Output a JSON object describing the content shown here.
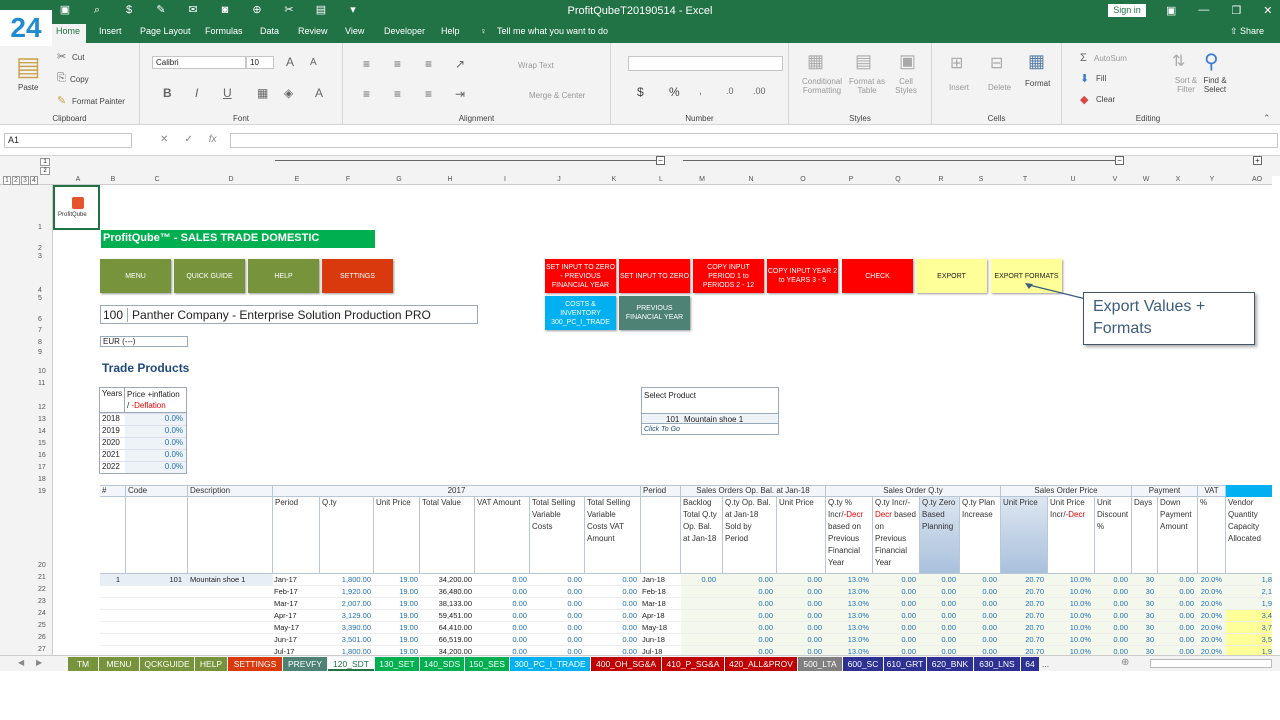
{
  "window": {
    "title": "ProfitQubeT20190514  -  Excel",
    "sign_in": "Sign in",
    "share": "Share",
    "tell_me": "Tell me what you want to do",
    "badge": "24"
  },
  "tabs": [
    "Home",
    "Insert",
    "Page Layout",
    "Formulas",
    "Data",
    "Review",
    "View",
    "Developer",
    "Help"
  ],
  "ribbon": {
    "clipboard": {
      "paste": "Paste",
      "cut": "Cut",
      "copy": "Copy",
      "format_painter": "Format Painter",
      "name": "Clipboard"
    },
    "font": {
      "family": "Calibri",
      "size": "10",
      "name": "Font"
    },
    "alignment": {
      "wrap": "Wrap Text",
      "merge": "Merge & Center",
      "name": "Alignment"
    },
    "number": {
      "name": "Number",
      "dollar": "$",
      "percent": "%"
    },
    "styles": {
      "cond": "Conditional Formatting",
      "fmt_table": "Format as Table",
      "cell_styles": "Cell Styles",
      "name": "Styles"
    },
    "cells": {
      "insert": "Insert",
      "delete": "Delete",
      "format": "Format",
      "name": "Cells"
    },
    "editing": {
      "autosum": "AutoSum",
      "fill": "Fill",
      "clear": "Clear",
      "sort": "Sort & Filter",
      "find": "Find & Select",
      "name": "Editing"
    }
  },
  "formula_bar": {
    "cell": "A1",
    "fx": "fx"
  },
  "outline_levels": [
    "1",
    "2",
    "3",
    "4"
  ],
  "columns": [
    "A",
    "B",
    "C",
    "D",
    "E",
    "F",
    "G",
    "H",
    "I",
    "J",
    "K",
    "L",
    "M",
    "N",
    "O",
    "P",
    "Q",
    "R",
    "S",
    "T",
    "U",
    "V",
    "W",
    "X",
    "Y",
    "AO"
  ],
  "rows": [
    "1",
    "2",
    "3",
    "4",
    "5",
    "6",
    "7",
    "8",
    "9",
    "10",
    "11",
    "12",
    "13",
    "14",
    "15",
    "16",
    "17",
    "18",
    "19",
    "20",
    "21",
    "22",
    "23",
    "24",
    "25",
    "26",
    "27"
  ],
  "sheet": {
    "logo_text": "ProfitQube",
    "title": "ProfitQube™ - SALES TRADE DOMESTIC",
    "nav_buttons": [
      "MENU",
      "QUICK GUIDE",
      "HELP",
      "SETTINGS"
    ],
    "action_buttons": {
      "set_zero_prev": "SET INPUT TO ZERO - PREVIOUS FINANCIAL YEAR",
      "set_zero": "SET INPUT TO ZERO",
      "copy_p1": "COPY INPUT PERIOD 1 to PERIODS  2 - 12",
      "copy_y2": "COPY INPUT YEAR 2 to YEARS  3 - 5",
      "check": "CHECK",
      "export": "EXPORT",
      "export_formats": "EXPORT FORMATS",
      "costs": "COSTS & INVENTORY 300_PC_I_TRADE",
      "prev_fy": "PREVIOUS FINANCIAL YEAR"
    },
    "callout": "Export Values  + Formats",
    "company_code": "100",
    "company_name": "Panther Company - Enterprise Solution Production PRO",
    "currency": "EUR (---)",
    "section": "Trade Products",
    "years_table": {
      "h1": "Years",
      "h2": "Price +inflation",
      "h3": "/ ",
      "h4": "-Deflation",
      "rows": [
        {
          "y": "2018",
          "v": "0.0%"
        },
        {
          "y": "2019",
          "v": "0.0%"
        },
        {
          "y": "2020",
          "v": "0.0%"
        },
        {
          "y": "2021",
          "v": "0.0%"
        },
        {
          "y": "2022",
          "v": "0.0%"
        }
      ]
    },
    "select_product": {
      "label": "Select Product",
      "code": "101",
      "name": "Mountain shoe 1",
      "link": "Click To Go"
    },
    "grid_headers": {
      "hash": "#",
      "code": "Code",
      "desc": "Description",
      "year": "2017",
      "period": "Period",
      "qty": "Q.ty",
      "unit_price": "Unit Price",
      "total_value": "Total Value",
      "vat_amount": "VAT Amount",
      "tsvc": "Total Selling Variable Costs",
      "tsvc_vat": "Total Selling Variable Costs VAT Amount",
      "period2": "Period",
      "so_group": "Sales Orders Op. Bal. at Jan-18",
      "backlog": "Backlog Total Q.ty Op. Bal. at Jan-18",
      "qty_op": "Q.ty Op. Bal. at Jan-18 Sold by Period",
      "unit_price2": "Unit Price",
      "soq_group": "Sales Order Q.ty",
      "incr": "Q.ty % Incr/",
      "decr": "-Decr",
      "incr_tail": "based on Previous Financial Year",
      "incr2": "Q.ty Incr/-",
      "decr2": "Decr",
      "incr2_tail": "based on Previous Financial Year",
      "zero": "Q.ty Zero Based Planning",
      "plan_inc": "Q.ty Plan Increase",
      "sop_group": "Sales Order Price",
      "unit_price3": "Unit Price",
      "price_incr": "Unit Price Incr/",
      "price_decr": "-Decr",
      "discount": "Unit Discount %",
      "pay_group": "Payment",
      "days": "Days",
      "down": "Down Payment Amount",
      "vat_group": "VAT",
      "vat_pct": "%",
      "vendor": "Vendor Quantity Capacity Allocated"
    },
    "data_rows": [
      {
        "n": "1",
        "code": "101",
        "desc": "Mountain shoe 1",
        "p": "Jan-17",
        "q": "1,800.00",
        "up": "19.00",
        "tv": "34,200.00",
        "va": "0.00",
        "c1": "0.00",
        "c2": "0.00",
        "p2": "Jan-18",
        "bl": "0.00",
        "s1": "0.00",
        "s2": "0.00",
        "pc": "13.0%",
        "a": "0.00",
        "b": "0.00",
        "c": "0.00",
        "u": "20.70",
        "ui": "10.0%",
        "d": "0.00",
        "days": "30",
        "dp": "0.00",
        "vp": "20.0%",
        "ao": "1,8"
      },
      {
        "n": "",
        "code": "",
        "desc": "",
        "p": "Feb-17",
        "q": "1,920.00",
        "up": "19.00",
        "tv": "36,480.00",
        "va": "0.00",
        "c1": "0.00",
        "c2": "0.00",
        "p2": "Feb-18",
        "bl": "",
        "s1": "0.00",
        "s2": "0.00",
        "pc": "13.0%",
        "a": "0.00",
        "b": "0.00",
        "c": "0.00",
        "u": "20.70",
        "ui": "10.0%",
        "d": "0.00",
        "days": "30",
        "dp": "0.00",
        "vp": "20.0%",
        "ao": "2,1"
      },
      {
        "n": "",
        "code": "",
        "desc": "",
        "p": "Mar-17",
        "q": "2,007.00",
        "up": "19.00",
        "tv": "38,133.00",
        "va": "0.00",
        "c1": "0.00",
        "c2": "0.00",
        "p2": "Mar-18",
        "bl": "",
        "s1": "0.00",
        "s2": "0.00",
        "pc": "13.0%",
        "a": "0.00",
        "b": "0.00",
        "c": "0.00",
        "u": "20.70",
        "ui": "10.0%",
        "d": "0.00",
        "days": "30",
        "dp": "0.00",
        "vp": "20.0%",
        "ao": "1,9"
      },
      {
        "n": "",
        "code": "",
        "desc": "",
        "p": "Apr-17",
        "q": "3,129.00",
        "up": "19.00",
        "tv": "59,451.00",
        "va": "0.00",
        "c1": "0.00",
        "c2": "0.00",
        "p2": "Apr-18",
        "bl": "",
        "s1": "0.00",
        "s2": "0.00",
        "pc": "13.0%",
        "a": "0.00",
        "b": "0.00",
        "c": "0.00",
        "u": "20.70",
        "ui": "10.0%",
        "d": "0.00",
        "days": "30",
        "dp": "0.00",
        "vp": "20.0%",
        "ao": "3,4"
      },
      {
        "n": "",
        "code": "",
        "desc": "",
        "p": "May-17",
        "q": "3,390.00",
        "up": "19.00",
        "tv": "64,410.00",
        "va": "0.00",
        "c1": "0.00",
        "c2": "0.00",
        "p2": "May-18",
        "bl": "",
        "s1": "0.00",
        "s2": "0.00",
        "pc": "13.0%",
        "a": "0.00",
        "b": "0.00",
        "c": "0.00",
        "u": "20.70",
        "ui": "10.0%",
        "d": "0.00",
        "days": "30",
        "dp": "0.00",
        "vp": "20.0%",
        "ao": "3,7"
      },
      {
        "n": "",
        "code": "",
        "desc": "",
        "p": "Jun-17",
        "q": "3,501.00",
        "up": "19.00",
        "tv": "66,519.00",
        "va": "0.00",
        "c1": "0.00",
        "c2": "0.00",
        "p2": "Jun-18",
        "bl": "",
        "s1": "0.00",
        "s2": "0.00",
        "pc": "13.0%",
        "a": "0.00",
        "b": "0.00",
        "c": "0.00",
        "u": "20.70",
        "ui": "10.0%",
        "d": "0.00",
        "days": "30",
        "dp": "0.00",
        "vp": "20.0%",
        "ao": "3,5"
      },
      {
        "n": "",
        "code": "",
        "desc": "",
        "p": "Jul-17",
        "q": "1,800.00",
        "up": "19.00",
        "tv": "34,200.00",
        "va": "0.00",
        "c1": "0.00",
        "c2": "0.00",
        "p2": "Jul-18",
        "bl": "",
        "s1": "0.00",
        "s2": "0.00",
        "pc": "13.0%",
        "a": "0.00",
        "b": "0.00",
        "c": "0.00",
        "u": "20.70",
        "ui": "10.0%",
        "d": "0.00",
        "days": "30",
        "dp": "0.00",
        "vp": "20.0%",
        "ao": "1,9"
      }
    ]
  },
  "sheet_tabs": [
    {
      "label": "TM",
      "color": "#77933c"
    },
    {
      "label": "MENU",
      "color": "#77933c"
    },
    {
      "label": "QCKGUIDE",
      "color": "#77933c"
    },
    {
      "label": "HELP",
      "color": "#77933c"
    },
    {
      "label": "SETTINGS",
      "color": "#d9390d"
    },
    {
      "label": "PREVFY",
      "color": "#4e8274"
    },
    {
      "label": "120_SDT",
      "color": "#ffffff"
    },
    {
      "label": "130_SET",
      "color": "#00b050"
    },
    {
      "label": "140_SDS",
      "color": "#00b050"
    },
    {
      "label": "150_SES",
      "color": "#00b050"
    },
    {
      "label": "300_PC_I_TRADE",
      "color": "#00b0f0"
    },
    {
      "label": "400_OH_SG&A",
      "color": "#c00000"
    },
    {
      "label": "410_P_SG&A",
      "color": "#c00000"
    },
    {
      "label": "420_ALL&PROV",
      "color": "#c00000"
    },
    {
      "label": "500_LTA",
      "color": "#808080"
    },
    {
      "label": "600_SC",
      "color": "#2e3192"
    },
    {
      "label": "610_GRT",
      "color": "#2e3192"
    },
    {
      "label": "620_BNK",
      "color": "#2e3192"
    },
    {
      "label": "630_LNS",
      "color": "#2e3192"
    },
    {
      "label": "64",
      "color": "#2e3192"
    }
  ],
  "sheet_tabs_more": "..."
}
